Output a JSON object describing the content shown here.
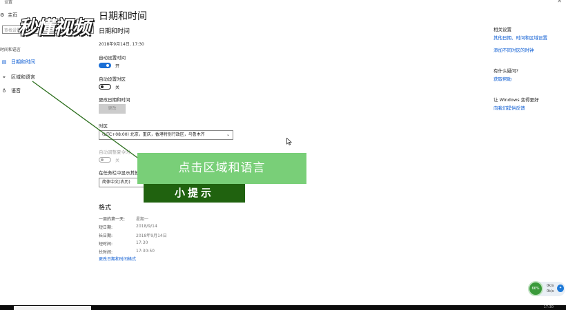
{
  "window": {
    "title": "设置",
    "close_glyph": "✕"
  },
  "logo": {
    "text": "秒懂视频"
  },
  "sidebar": {
    "home": "主页",
    "search_placeholder": "查找设置",
    "section": "时间和语言",
    "items": [
      {
        "label": "日期和时间",
        "icon": "calendar-clock-icon",
        "active": true
      },
      {
        "label": "区域和语言",
        "icon": "globe-region-icon",
        "active": false
      },
      {
        "label": "语音",
        "icon": "microphone-icon",
        "active": false
      }
    ]
  },
  "main": {
    "title": "日期和时间",
    "subtitle": "日期和时间",
    "current_datetime": "2018年9月14日, 17:30",
    "auto_time": {
      "label": "自动设置时间",
      "state": "开"
    },
    "auto_zone": {
      "label": "自动设置时区",
      "state": "关"
    },
    "change": {
      "label": "更改日期和时间",
      "button": "更改"
    },
    "timezone": {
      "label": "时区",
      "value": "(UTC+08:00) 北京，重庆，香港特别行政区，乌鲁木齐"
    },
    "dst": {
      "label": "自动调整夏令时",
      "state": "关"
    },
    "taskbar_cal": {
      "label": "在任务栏中显示其他日历",
      "value": "简体中文(农历)"
    },
    "format": {
      "title": "格式",
      "rows": [
        {
          "k": "一周的第一天:",
          "v": "星期一"
        },
        {
          "k": "短日期:",
          "v": "2018/9/14"
        },
        {
          "k": "长日期:",
          "v": "2018年9月14日"
        },
        {
          "k": "短时间:",
          "v": "17:30"
        },
        {
          "k": "长时间:",
          "v": "17:30:50"
        }
      ],
      "link": "更改日期和时间格式"
    }
  },
  "right": {
    "related_title": "相关设置",
    "related_links": [
      "其他日期、时间和区域设置",
      "添加不同时区的时钟"
    ],
    "help_title": "有什么疑问?",
    "help_link": "获取帮助",
    "better_title": "让 Windows 变得更好",
    "better_link": "向我们提供反馈"
  },
  "overlay": {
    "banner": "点击区域和语言",
    "tip": "小提示"
  },
  "widget": {
    "percent": "66%",
    "up": "0k/s",
    "down": "0k/s"
  },
  "taskbar": {
    "clock": "17:30"
  },
  "colors": {
    "accent": "#0a5bd3",
    "banner_green": "#79cf78",
    "tip_green": "#20620f"
  }
}
